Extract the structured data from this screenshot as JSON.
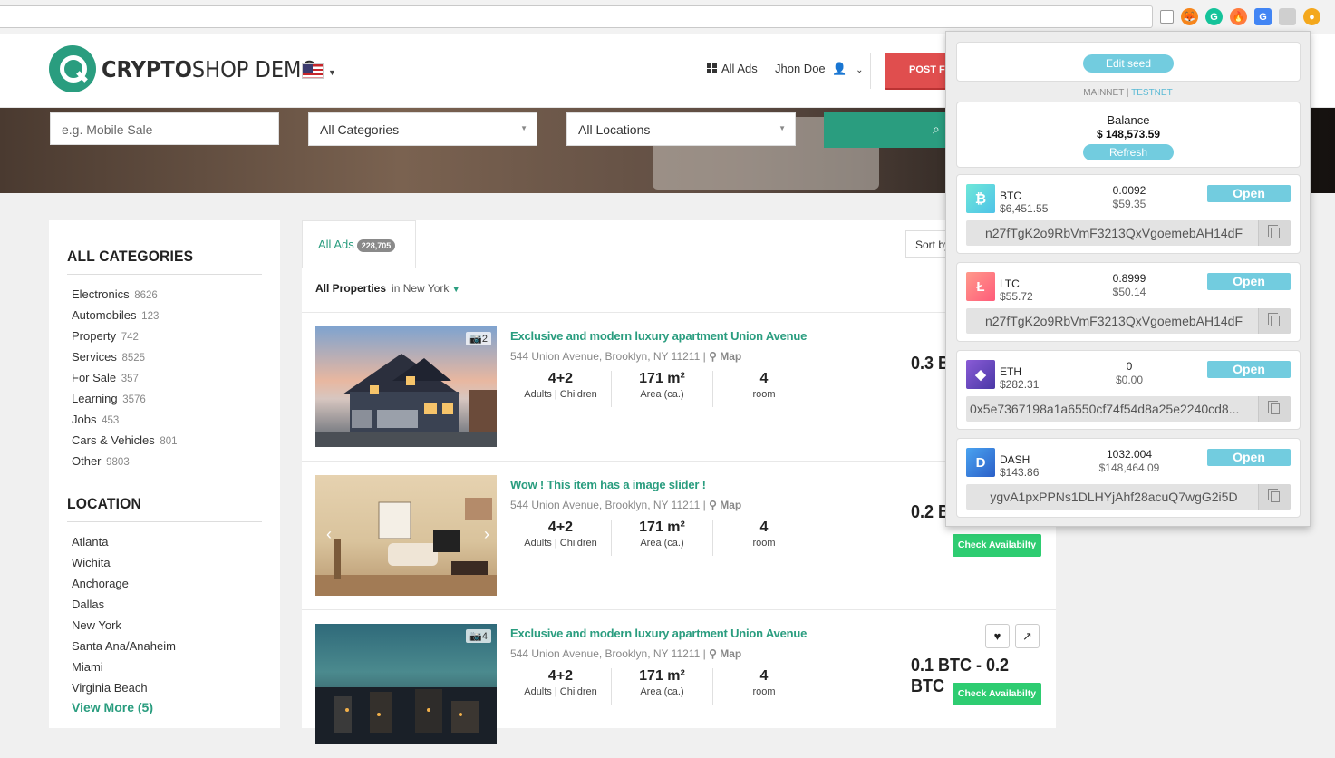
{
  "header": {
    "logo_bold": "CRYPTO",
    "logo_rest": "SHOP DEMO",
    "all_ads": "All Ads",
    "user": "Jhon Doe",
    "post_button": "POST FR"
  },
  "search": {
    "keyword_placeholder": "e.g. Mobile Sale",
    "category": "All Categories",
    "location": "All Locations"
  },
  "sidebar": {
    "categories_title": "ALL CATEGORIES",
    "categories": [
      {
        "name": "Electronics",
        "count": "8626"
      },
      {
        "name": "Automobiles",
        "count": "123"
      },
      {
        "name": "Property",
        "count": "742"
      },
      {
        "name": "Services",
        "count": "8525"
      },
      {
        "name": "For Sale",
        "count": "357"
      },
      {
        "name": "Learning",
        "count": "3576"
      },
      {
        "name": "Jobs",
        "count": "453"
      },
      {
        "name": "Cars & Vehicles",
        "count": "801"
      },
      {
        "name": "Other",
        "count": "9803"
      }
    ],
    "location_title": "LOCATION",
    "locations": [
      "Atlanta",
      "Wichita",
      "Anchorage",
      "Dallas",
      "New York",
      "Santa Ana/Anaheim",
      "Miami",
      "Virginia Beach"
    ],
    "view_more": "View More (5)"
  },
  "main": {
    "tab_label": "All Ads",
    "tab_count": "228,705",
    "sort_label": "Sort by",
    "filter_label": "All Properties",
    "filter_location": "in New York",
    "check_label": "Check Availabilty",
    "map_label": "Map",
    "stat_labels": [
      "Adults | Children",
      "Area (ca.)",
      "room"
    ],
    "items": [
      {
        "title": "Exclusive and modern luxury apartment Union Avenue",
        "address": "544 Union Avenue, Brooklyn, NY 11211 |",
        "photos": "2",
        "guests": "4+2",
        "area": "171 m²",
        "rooms": "4",
        "price": "0.3 B"
      },
      {
        "title": "Wow ! This item has a image slider !",
        "address": "544 Union Avenue, Brooklyn, NY 11211 |",
        "photos": "",
        "guests": "4+2",
        "area": "171 m²",
        "rooms": "4",
        "price": "0.2 B"
      },
      {
        "title": "Exclusive and modern luxury apartment Union Avenue",
        "address": "544 Union Avenue, Brooklyn, NY 11211 |",
        "photos": "4",
        "guests": "4+2",
        "area": "171 m²",
        "rooms": "4",
        "price": "0.1 BTC - 0.2 BTC"
      }
    ]
  },
  "wallet": {
    "edit_seed": "Edit seed",
    "mainnet": "MAINNET",
    "separator": "|",
    "testnet": "TESTNET",
    "balance_label": "Balance",
    "balance_value": "$ 148,573.59",
    "refresh": "Refresh",
    "open_label": "Open",
    "coins": [
      {
        "symbol": "BTC",
        "price": "$6,451.55",
        "amount": "0.0092",
        "value": "$59.35",
        "address": "n27fTgK2o9RbVmF3213QxVgoemebAH14dF",
        "color": "#5fd3d6"
      },
      {
        "symbol": "LTC",
        "price": "$55.72",
        "amount": "0.8999",
        "value": "$50.14",
        "address": "n27fTgK2o9RbVmF3213QxVgoemebAH14dF",
        "color": "#ff6b81"
      },
      {
        "symbol": "ETH",
        "price": "$282.31",
        "amount": "0",
        "value": "$0.00",
        "address": "0x5e7367198a1a6550cf74f54d8a25e2240cd8...",
        "color": "#6a4fb0"
      },
      {
        "symbol": "DASH",
        "price": "$143.86",
        "amount": "1032.004",
        "value": "$148,464.09",
        "address": "ygvA1pxPPNs1DLHYjAhf28acuQ7wgG2i5D",
        "color": "#2f7bd8"
      }
    ]
  }
}
